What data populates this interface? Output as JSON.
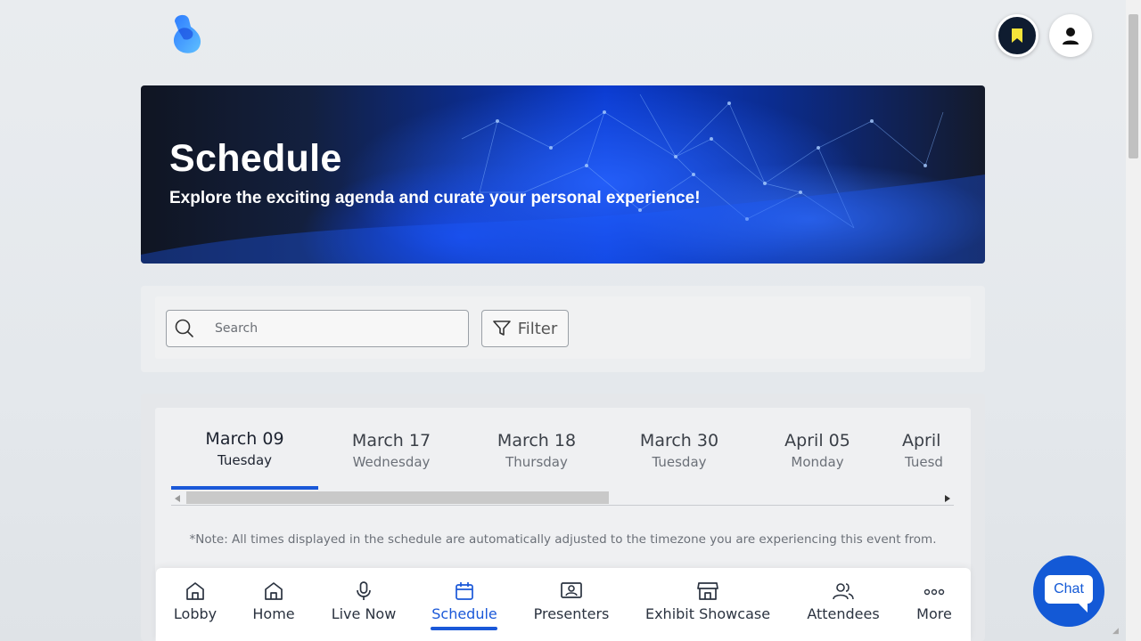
{
  "header": {
    "logo_icon": "brand-logo-icon",
    "bookmark_icon": "bookmark-icon",
    "profile_icon": "user-icon"
  },
  "hero": {
    "title": "Schedule",
    "subtitle": "Explore the exciting agenda and curate your personal experience!"
  },
  "search": {
    "placeholder": "Search",
    "value": "",
    "filter_label": "Filter"
  },
  "dates": [
    {
      "date": "March 09",
      "weekday": "Tuesday",
      "active": true
    },
    {
      "date": "March 17",
      "weekday": "Wednesday",
      "active": false
    },
    {
      "date": "March 18",
      "weekday": "Thursday",
      "active": false
    },
    {
      "date": "March 30",
      "weekday": "Tuesday",
      "active": false
    },
    {
      "date": "April 05",
      "weekday": "Monday",
      "active": false
    },
    {
      "date": "April",
      "weekday": "Tuesd",
      "active": false
    }
  ],
  "note": "*Note: All times displayed in the schedule are automatically adjusted to the timezone you are experiencing this event from.",
  "nav": [
    {
      "label": "Lobby",
      "icon": "lobby-icon",
      "active": false
    },
    {
      "label": "Home",
      "icon": "home-icon",
      "active": false
    },
    {
      "label": "Live Now",
      "icon": "microphone-icon",
      "active": false
    },
    {
      "label": "Schedule",
      "icon": "calendar-icon",
      "active": true
    },
    {
      "label": "Presenters",
      "icon": "presenter-icon",
      "active": false
    },
    {
      "label": "Exhibit Showcase",
      "icon": "storefront-icon",
      "active": false
    },
    {
      "label": "Attendees",
      "icon": "people-icon",
      "active": false
    },
    {
      "label": "More",
      "icon": "more-dots-icon",
      "active": false
    }
  ],
  "chat": {
    "label": "Chat"
  },
  "colors": {
    "accent": "#1a58d8",
    "chat": "#1359d6",
    "bookmark_bg": "#0f1c30",
    "bookmark_icon": "#f5e43a"
  }
}
